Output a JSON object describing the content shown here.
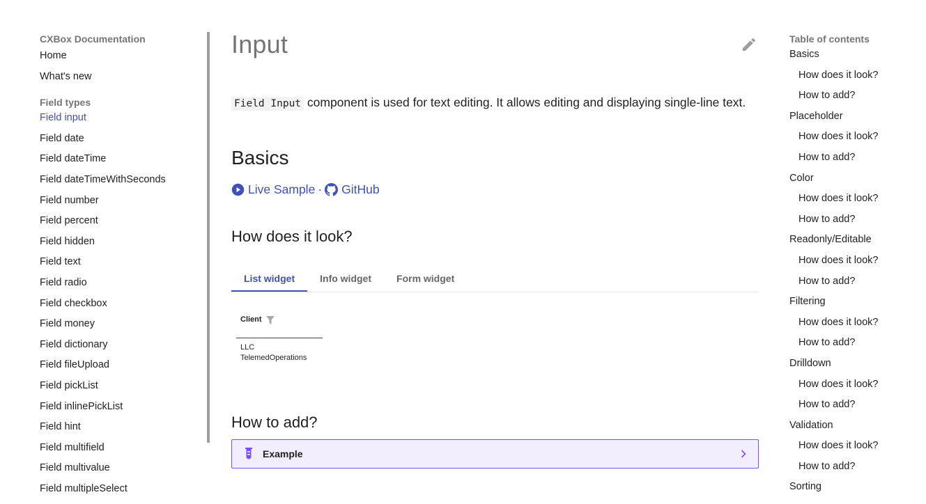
{
  "left_nav": {
    "section1_title": "CXBox Documentation",
    "section1_items": [
      "Home",
      "What's new"
    ],
    "section2_title": "Field types",
    "section2_items": [
      "Field input",
      "Field date",
      "Field dateTime",
      "Field dateTimeWithSeconds",
      "Field number",
      "Field percent",
      "Field hidden",
      "Field text",
      "Field radio",
      "Field checkbox",
      "Field money",
      "Field dictionary",
      "Field fileUpload",
      "Field pickList",
      "Field inlinePickList",
      "Field hint",
      "Field multifield",
      "Field multivalue",
      "Field multipleSelect"
    ],
    "active_item": "Field input"
  },
  "main": {
    "title": "Input",
    "intro_code": "Field Input",
    "intro_text": " component is used for text editing. It allows editing and displaying single-line text.",
    "basics_heading": "Basics",
    "link_live_sample": "Live Sample",
    "link_separator": "·",
    "link_github": "GitHub",
    "look_heading": "How does it look?",
    "tabs": [
      "List widget",
      "Info widget",
      "Form widget"
    ],
    "active_tab": "List widget",
    "widget": {
      "column_header": "Client",
      "cell_line1": "LLC",
      "cell_line2": "TelemedOperations"
    },
    "add_heading": "How to add?",
    "example_label": "Example"
  },
  "toc": {
    "title": "Table of contents",
    "items": [
      {
        "label": "Basics",
        "level": 1
      },
      {
        "label": "How does it look?",
        "level": 2
      },
      {
        "label": "How to add?",
        "level": 2
      },
      {
        "label": "Placeholder",
        "level": 1
      },
      {
        "label": "How does it look?",
        "level": 2
      },
      {
        "label": "How to add?",
        "level": 2
      },
      {
        "label": "Color",
        "level": 1
      },
      {
        "label": "How does it look?",
        "level": 2
      },
      {
        "label": "How to add?",
        "level": 2
      },
      {
        "label": "Readonly/Editable",
        "level": 1
      },
      {
        "label": "How does it look?",
        "level": 2
      },
      {
        "label": "How to add?",
        "level": 2
      },
      {
        "label": "Filtering",
        "level": 1
      },
      {
        "label": "How does it look?",
        "level": 2
      },
      {
        "label": "How to add?",
        "level": 2
      },
      {
        "label": "Drilldown",
        "level": 1
      },
      {
        "label": "How does it look?",
        "level": 2
      },
      {
        "label": "How to add?",
        "level": 2
      },
      {
        "label": "Validation",
        "level": 1
      },
      {
        "label": "How does it look?",
        "level": 2
      },
      {
        "label": "How to add?",
        "level": 2
      },
      {
        "label": "Sorting",
        "level": 1
      }
    ]
  },
  "colors": {
    "accent": "#3f51b5",
    "example_border": "#7c4dff",
    "example_bg": "#f3eefe"
  },
  "icons": {
    "edit": "pencil-icon",
    "live_sample": "play-circle-icon",
    "github": "github-icon",
    "filter": "filter-icon",
    "example": "test-tube-icon",
    "chevron": "chevron-right-icon"
  }
}
